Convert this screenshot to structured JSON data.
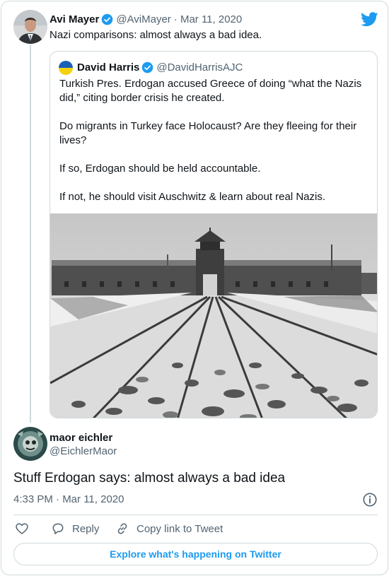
{
  "tweet": {
    "author_name": "Avi Mayer",
    "author_handle": "@AviMayer",
    "date": "· Mar 11, 2020",
    "text": "Nazi comparisons: almost always a bad idea."
  },
  "quoted_tweet": {
    "author_name": "David Harris",
    "author_handle": "@DavidHarrisAJC",
    "paragraphs": [
      "Turkish Pres. Erdogan accused Greece of doing “what the Nazis did,” citing border crisis he created.",
      "Do migrants in Turkey face Holocaust? Are they fleeing for their lives?",
      "If so, Erdogan should be held accountable.",
      "If not, he should visit Auschwitz & learn about real Nazis."
    ]
  },
  "reply": {
    "author_name": "maor eichler",
    "author_handle": "@EichlerMaor",
    "text": "Stuff Erdogan says: almost always a bad idea",
    "timestamp": "4:33 PM · Mar 11, 2020"
  },
  "actions": {
    "reply_label": "Reply",
    "copy_link_label": "Copy link to Tweet"
  },
  "footer": {
    "explore_label": "Explore what's happening on Twitter"
  },
  "colors": {
    "accent": "#1d9bf0",
    "muted": "#536471",
    "border": "#cfd9de"
  }
}
